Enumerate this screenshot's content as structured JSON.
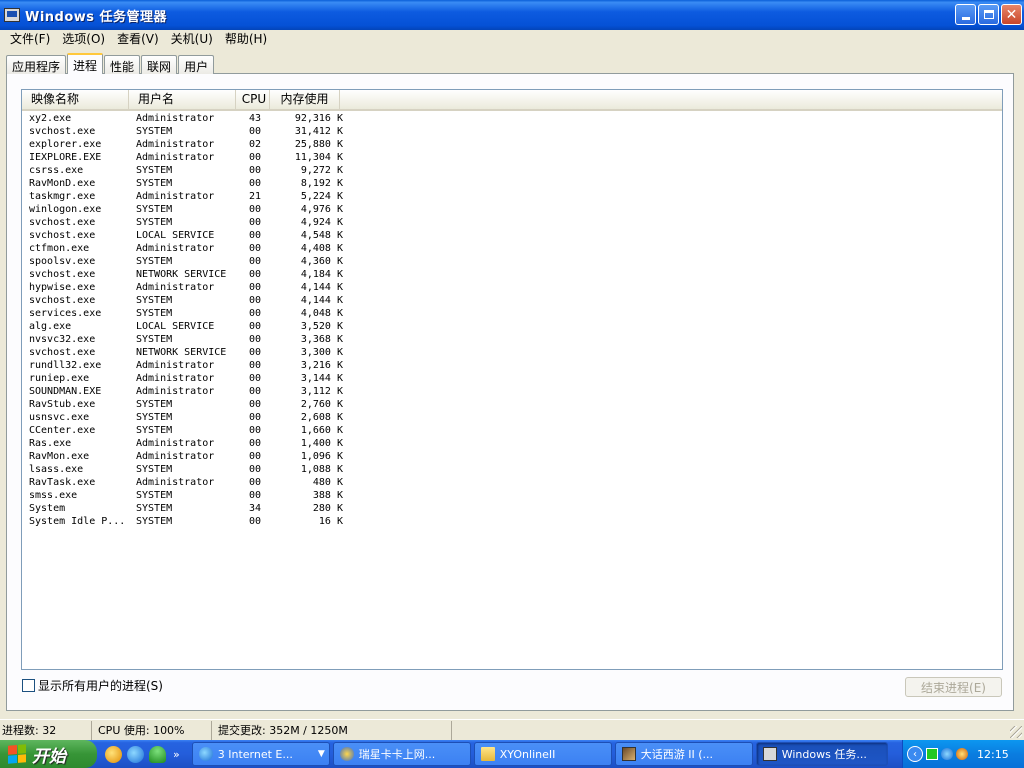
{
  "window": {
    "title": "Windows 任务管理器"
  },
  "menu": [
    "文件(F)",
    "选项(O)",
    "查看(V)",
    "关机(U)",
    "帮助(H)"
  ],
  "tabs": [
    {
      "label": "应用程序",
      "active": false
    },
    {
      "label": "进程",
      "active": true
    },
    {
      "label": "性能",
      "active": false
    },
    {
      "label": "联网",
      "active": false
    },
    {
      "label": "用户",
      "active": false
    }
  ],
  "columns": {
    "image": "映像名称",
    "user": "用户名",
    "cpu": "CPU",
    "mem": "内存使用"
  },
  "processes": [
    [
      "xy2.exe",
      "Administrator",
      "43",
      "92,316 K"
    ],
    [
      "svchost.exe",
      "SYSTEM",
      "00",
      "31,412 K"
    ],
    [
      "explorer.exe",
      "Administrator",
      "02",
      "25,880 K"
    ],
    [
      "IEXPLORE.EXE",
      "Administrator",
      "00",
      "11,304 K"
    ],
    [
      "csrss.exe",
      "SYSTEM",
      "00",
      "9,272 K"
    ],
    [
      "RavMonD.exe",
      "SYSTEM",
      "00",
      "8,192 K"
    ],
    [
      "taskmgr.exe",
      "Administrator",
      "21",
      "5,224 K"
    ],
    [
      "winlogon.exe",
      "SYSTEM",
      "00",
      "4,976 K"
    ],
    [
      "svchost.exe",
      "SYSTEM",
      "00",
      "4,924 K"
    ],
    [
      "svchost.exe",
      "LOCAL SERVICE",
      "00",
      "4,548 K"
    ],
    [
      "ctfmon.exe",
      "Administrator",
      "00",
      "4,408 K"
    ],
    [
      "spoolsv.exe",
      "SYSTEM",
      "00",
      "4,360 K"
    ],
    [
      "svchost.exe",
      "NETWORK SERVICE",
      "00",
      "4,184 K"
    ],
    [
      "hypwise.exe",
      "Administrator",
      "00",
      "4,144 K"
    ],
    [
      "svchost.exe",
      "SYSTEM",
      "00",
      "4,144 K"
    ],
    [
      "services.exe",
      "SYSTEM",
      "00",
      "4,048 K"
    ],
    [
      "alg.exe",
      "LOCAL SERVICE",
      "00",
      "3,520 K"
    ],
    [
      "nvsvc32.exe",
      "SYSTEM",
      "00",
      "3,368 K"
    ],
    [
      "svchost.exe",
      "NETWORK SERVICE",
      "00",
      "3,300 K"
    ],
    [
      "rundll32.exe",
      "Administrator",
      "00",
      "3,216 K"
    ],
    [
      "runiep.exe",
      "Administrator",
      "00",
      "3,144 K"
    ],
    [
      "SOUNDMAN.EXE",
      "Administrator",
      "00",
      "3,112 K"
    ],
    [
      "RavStub.exe",
      "SYSTEM",
      "00",
      "2,760 K"
    ],
    [
      "usnsvc.exe",
      "SYSTEM",
      "00",
      "2,608 K"
    ],
    [
      "CCenter.exe",
      "SYSTEM",
      "00",
      "1,660 K"
    ],
    [
      "Ras.exe",
      "Administrator",
      "00",
      "1,400 K"
    ],
    [
      "RavMon.exe",
      "Administrator",
      "00",
      "1,096 K"
    ],
    [
      "lsass.exe",
      "SYSTEM",
      "00",
      "1,088 K"
    ],
    [
      "RavTask.exe",
      "Administrator",
      "00",
      "480 K"
    ],
    [
      "smss.exe",
      "SYSTEM",
      "00",
      "388 K"
    ],
    [
      "System",
      "SYSTEM",
      "34",
      "280 K"
    ],
    [
      "System Idle P...",
      "SYSTEM",
      "00",
      "16 K"
    ]
  ],
  "show_all": {
    "label": "显示所有用户的进程(S)"
  },
  "end_process": {
    "label": "结束进程(E)"
  },
  "status": {
    "processes": "进程数: 32",
    "cpu": "CPU 使用: 100%",
    "commit": "提交更改: 352M / 1250M"
  },
  "taskbar": {
    "start_label": "开始",
    "quick_chevron": "»",
    "buttons": [
      {
        "label": "3 Internet E...",
        "icon": "ie-icon",
        "has_dropdown": true,
        "active": false
      },
      {
        "label": "瑞星卡卡上网...",
        "icon": "rising-icon",
        "active": false
      },
      {
        "label": "XYOnlineII",
        "icon": "folder-icon",
        "active": false
      },
      {
        "label": "大话西游 II (...",
        "icon": "game-icon",
        "active": false
      },
      {
        "label": "Windows 任务...",
        "icon": "taskmgr-icon",
        "active": true
      }
    ],
    "clock": "12:15"
  }
}
